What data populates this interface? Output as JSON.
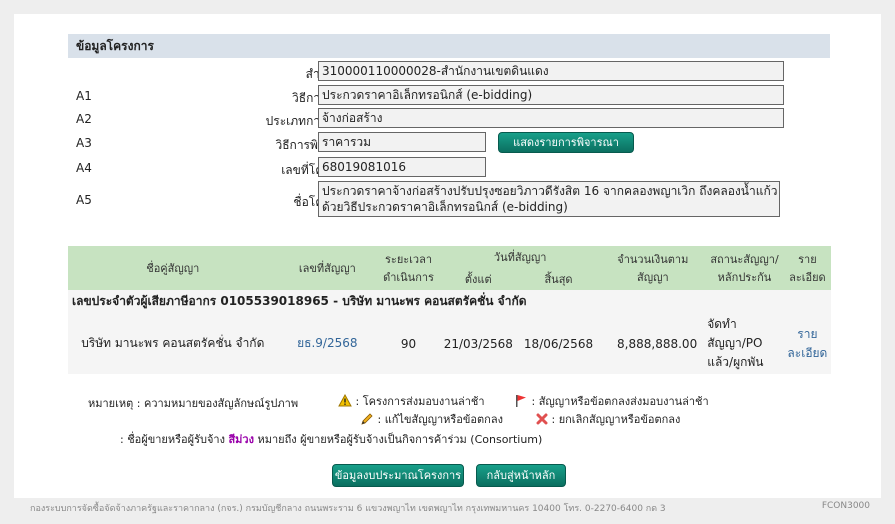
{
  "section_title": "ข้อมูลโครงการ",
  "fields": {
    "agency_label": "สำนักงาน",
    "agency_value": "310000110000028-สำนักงานเขตดินแดง",
    "a1_code": "A1",
    "a1_label": "วิธีการจัดหา",
    "a1_value": "ประกวดราคาอิเล็กทรอนิกส์ (e-bidding)",
    "a2_code": "A2",
    "a2_label": "ประเภทการจัดหา",
    "a2_value": "จ้างก่อสร้าง",
    "a3_code": "A3",
    "a3_label": "วิธีการพิจารณา",
    "a3_value": "ราคารวม",
    "a3_button": "แสดงรายการพิจารณา",
    "a4_code": "A4",
    "a4_label": "เลขที่โครงการ",
    "a4_value": "68019081016",
    "a5_code": "A5",
    "a5_label": "ชื่อโครงการ",
    "a5_value": "ประกวดราคาจ้างก่อสร้างปรับปรุงซอยวิภาวดีรังสิต 16 จากคลองพญาเวิก ถึงคลองน้ำแก้ว ด้วยวิธีประกวดราคาอิเล็กทรอนิกส์ (e-bidding)"
  },
  "table": {
    "headers": {
      "party": "ชื่อคู่สัญญา",
      "contract_no": "เลขที่สัญญา",
      "duration": "ระยะเวลาดำเนินการ",
      "contract_date": "วันที่สัญญา",
      "start": "ตั้งแต่",
      "end": "สิ้นสุด",
      "amount": "จำนวนเงินตามสัญญา",
      "status": "สถานะสัญญา/หลักประกัน",
      "detail": "รายละเอียด"
    },
    "tax_row": "เลขประจำตัวผู้เสียภาษีอากร 0105539018965 - บริษัท มานะพร คอนสตรัคชั่น จำกัด",
    "row": {
      "party": "บริษัท มานะพร คอนสตรัคชั่น จำกัด",
      "contract_no": "ยธ.9/2568",
      "duration": "90",
      "start": "21/03/2568",
      "end": "18/06/2568",
      "amount": "8,888,888.00",
      "status": "จัดทำสัญญา/PO แล้ว/ผูกพัน",
      "detail": "รายละเอียด"
    }
  },
  "notes": {
    "title": "หมายเหตุ : ความหมายของสัญลักษณ์รูปภาพ",
    "warn": ": โครงการส่งมอบงานล่าช้า",
    "flag": ": สัญญาหรือข้อตกลงส่งมอบงานล่าช้า",
    "edit": ": แก้ไขสัญญาหรือข้อตกลง",
    "cancel": ": ยกเลิกสัญญาหรือข้อตกลง",
    "consortium_prefix": ": ชื่อผู้ขายหรือผู้รับจ้าง",
    "consortium_purple": "สีม่วง",
    "consortium_suffix": "หมายถึง ผู้ขายหรือผู้รับจ้างเป็นกิจการค้าร่วม (Consortium)"
  },
  "buttons": {
    "budget": "ข้อมูลงบประมาณโครงการ",
    "back": "กลับสู่หน้าหลัก"
  },
  "footer": {
    "text": "กองระบบการจัดซื้อจัดจ้างภาครัฐและราคากลาง (กจร.) กรมบัญชีกลาง ถนนพระราม 6 แขวงพญาไท เขตพญาไท กรุงเทพมหานคร 10400 โทร. 0-2270-6400 กด 3",
    "code": "FCON3000"
  },
  "colors": {
    "header_bg": "#d9e1ea",
    "table_header_bg": "#c7e3c1",
    "button_teal": "#0b6f60",
    "consortium_purple": "#9900aa"
  }
}
